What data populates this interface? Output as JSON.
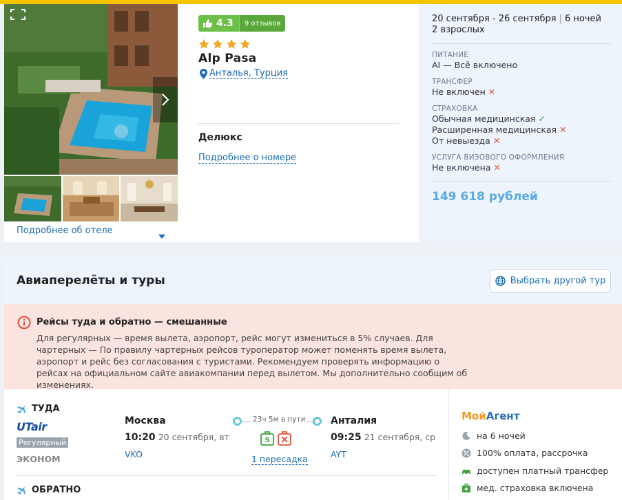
{
  "hotel": {
    "rating": "4.3",
    "reviews": "9 отзывов",
    "stars": 4,
    "name": "Alp Pasa",
    "location": "Анталья, Турция",
    "room_type": "Делюкс",
    "room_more": "Подробнее о номере",
    "hotel_more": "Подробнее об отеле"
  },
  "details": {
    "dates": "20 сентября - 26 сентября",
    "nights": "6 ночей",
    "guests": "2 взрослых",
    "meal_label": "Питание",
    "meal_value": "AI — Всё включено",
    "transfer_label": "Трансфер",
    "transfer_value": "Не включен",
    "insurance_label": "Страховка",
    "insurance_items": [
      "Обычная медицинская",
      "Расширенная медицинская",
      "От невыезда"
    ],
    "visa_label": "Услуга визового оформления",
    "visa_value": "Не включена",
    "price": "149 618 рублей"
  },
  "flights": {
    "title": "Авиаперелёты и туры",
    "choose_button": "Выбрать другой тур",
    "warning_title": "Рейсы туда и обратно — смешанные",
    "warning_text": "Для регулярных — время вылета, аэропорт, рейс могут измениться в 5% случаев. Для чартерных — По правилу чартерных рейсов туроператор может поменять время вылета, аэропорт и рейс без согласования с туристами. Рекомендуем проверять информацию о рейсах на официальном сайте авиакомпании перед вылетом. Мы дополнительно сообщим об изменениях.",
    "outbound_label": "ТУДА",
    "return_label": "ОБРАТНО",
    "airline": "UTair",
    "flight_kind": "Регулярный",
    "cabin": "ЭКОНОМ",
    "from_city": "Москва",
    "from_time": "10:20",
    "from_date": "20 сентября, вт",
    "from_code": "VKO",
    "to_city": "Анталия",
    "to_time": "09:25",
    "to_date": "21 сентября, ср",
    "to_code": "AYT",
    "duration": "23ч 5м в пути",
    "transfers": "1 пересадка"
  },
  "agent": {
    "logo_part1": "Мой",
    "logo_part2": "Агент",
    "items": [
      "на 6 ночей",
      "100% оплата, рассрочка",
      "доступен платный трансфер",
      "мед. страховка включена"
    ]
  },
  "colors": {
    "accent_blue": "#1a6cb5",
    "rating_green": "#6cc04a",
    "price_blue": "#5aa9e0",
    "warning_bg": "#fbe3df",
    "top_bar": "#f7c500"
  }
}
